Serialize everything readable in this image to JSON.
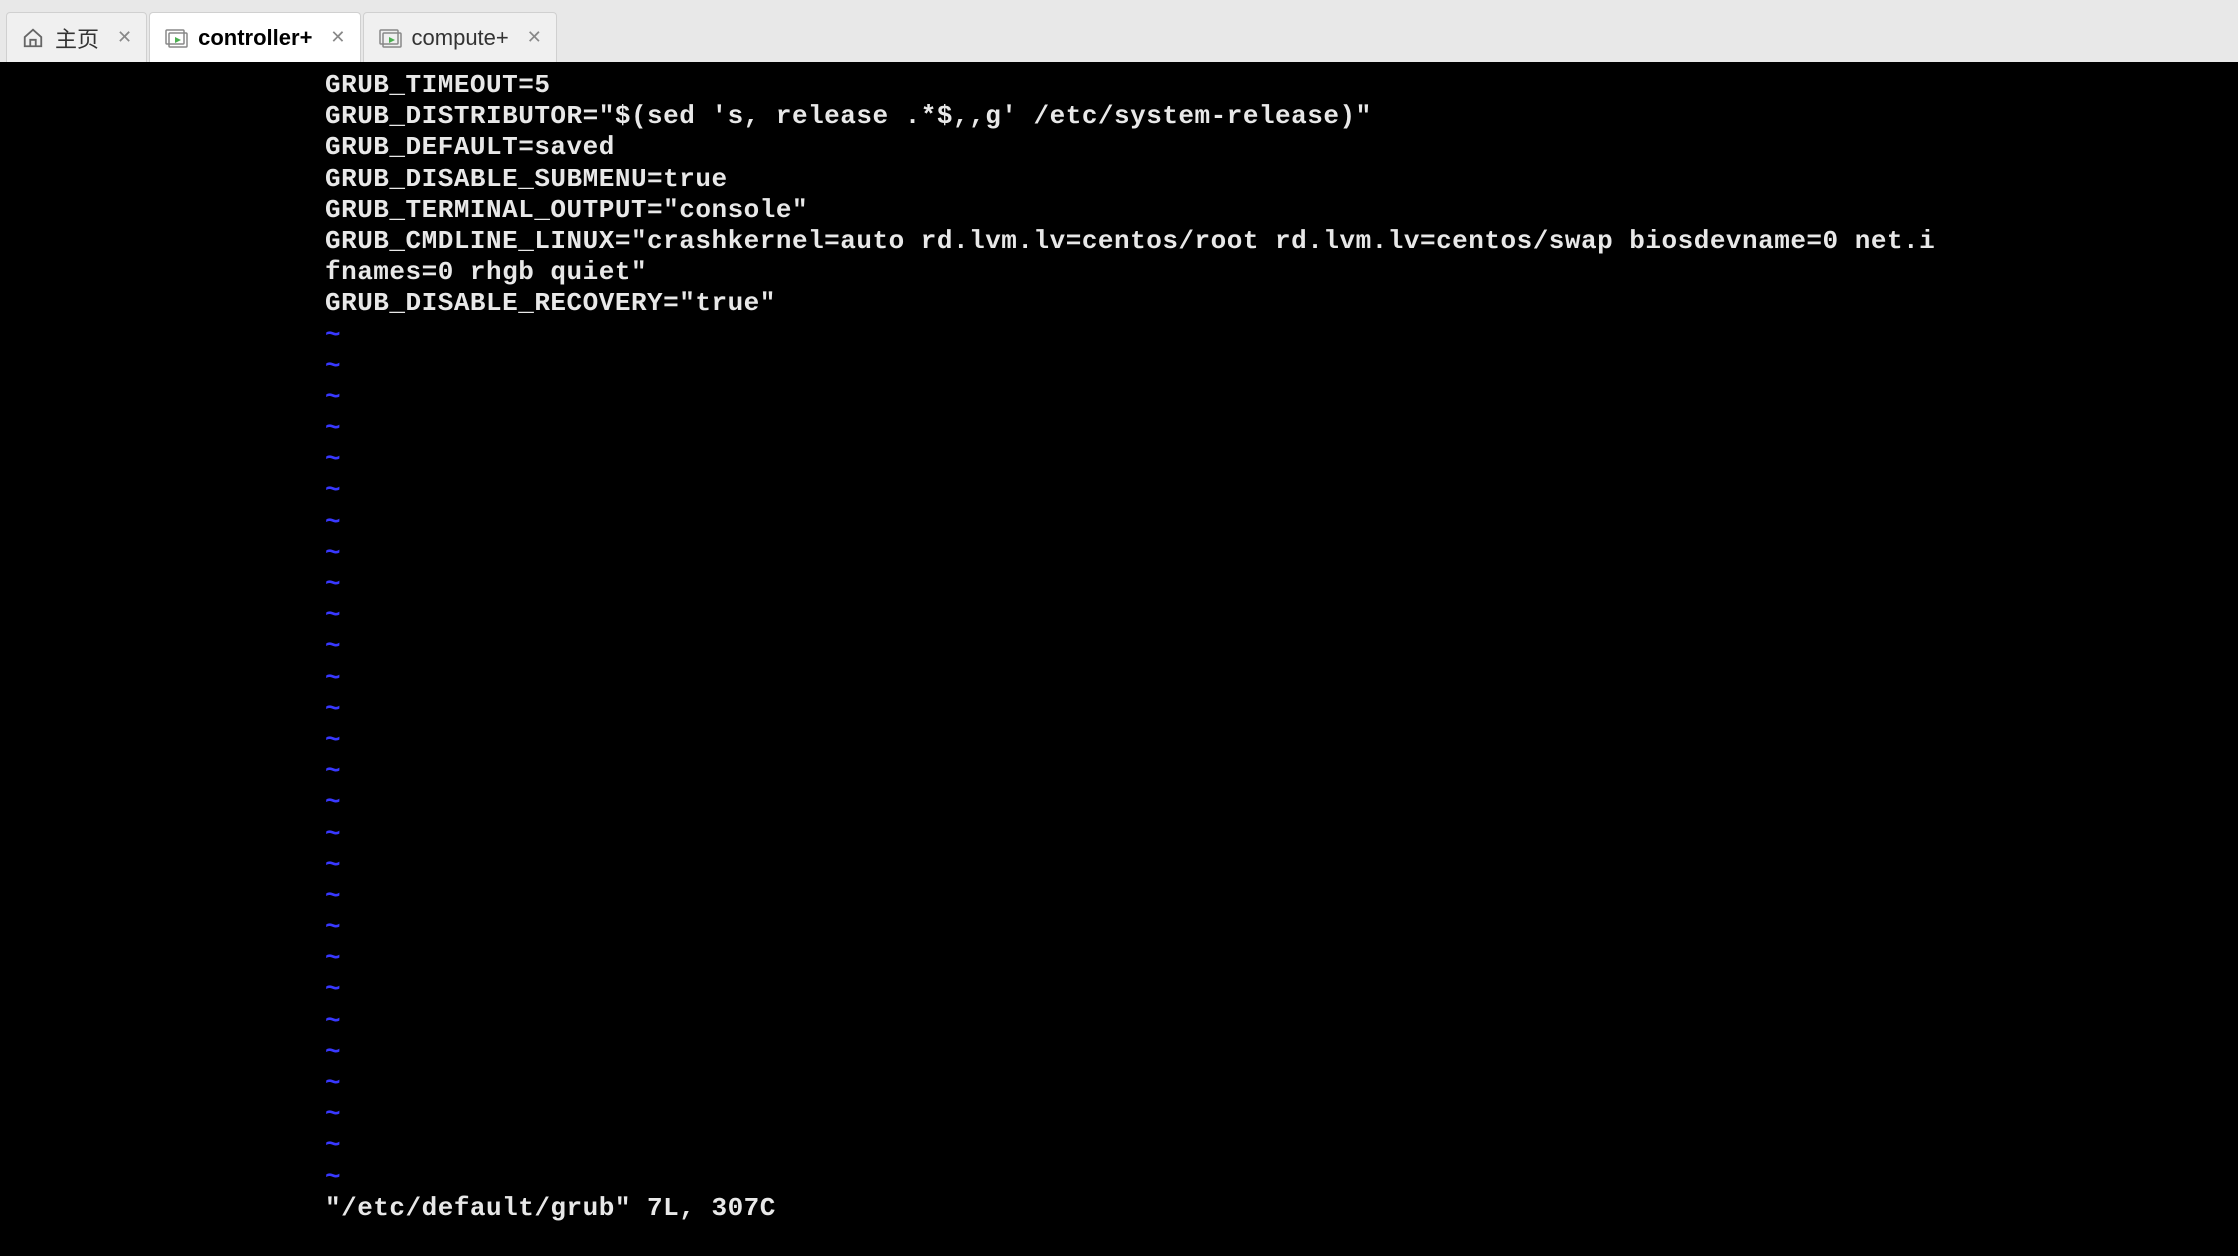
{
  "tabs": [
    {
      "label": "主页",
      "icon": "home-icon",
      "closable": true,
      "active": false
    },
    {
      "label": "controller+",
      "icon": "vm-icon",
      "closable": true,
      "active": true
    },
    {
      "label": "compute+",
      "icon": "vm-icon",
      "closable": true,
      "active": false
    }
  ],
  "terminal": {
    "file_lines": [
      "GRUB_TIMEOUT=5",
      "GRUB_DISTRIBUTOR=\"$(sed 's, release .*$,,g' /etc/system-release)\"",
      "GRUB_DEFAULT=saved",
      "GRUB_DISABLE_SUBMENU=true",
      "GRUB_TERMINAL_OUTPUT=\"console\"",
      "GRUB_CMDLINE_LINUX=\"crashkernel=auto rd.lvm.lv=centos/root rd.lvm.lv=centos/swap biosdevname=0 net.i",
      "fnames=0 rhgb quiet\"",
      "GRUB_DISABLE_RECOVERY=\"true\""
    ],
    "tilde_count": 28,
    "tilde_char": "~",
    "status": "\"/etc/default/grub\" 7L, 307C"
  }
}
